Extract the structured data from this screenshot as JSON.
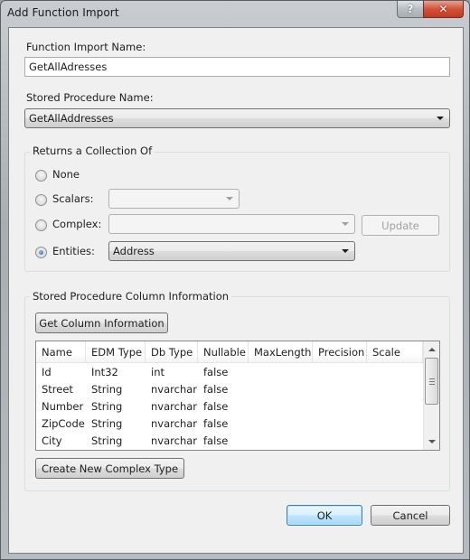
{
  "window": {
    "title": "Add Function Import",
    "help_glyph": "?",
    "close_glyph": "✕"
  },
  "function_import": {
    "label": "Function Import Name:",
    "value": "GetAllAdresses"
  },
  "stored_procedure": {
    "label": "Stored Procedure Name:",
    "selected": "GetAllAddresses"
  },
  "returns_group": {
    "title": "Returns a Collection Of",
    "options": [
      {
        "label": "None",
        "checked": false
      },
      {
        "label": "Scalars:",
        "checked": false,
        "value": ""
      },
      {
        "label": "Complex:",
        "checked": false,
        "value": ""
      },
      {
        "label": "Entities:",
        "checked": true,
        "value": "Address"
      }
    ],
    "update_button": "Update"
  },
  "column_info_group": {
    "title": "Stored Procedure Column Information",
    "get_button": "Get Column Information",
    "columns": [
      "Name",
      "EDM Type",
      "Db Type",
      "Nullable",
      "MaxLength",
      "Precision",
      "Scale"
    ],
    "rows": [
      [
        "Id",
        "Int32",
        "int",
        "false",
        "",
        "",
        ""
      ],
      [
        "Street",
        "String",
        "nvarchar",
        "false",
        "",
        "",
        ""
      ],
      [
        "Number",
        "String",
        "nvarchar",
        "false",
        "",
        "",
        ""
      ],
      [
        "ZipCode",
        "String",
        "nvarchar",
        "false",
        "",
        "",
        ""
      ],
      [
        "City",
        "String",
        "nvarchar",
        "false",
        "",
        "",
        ""
      ]
    ],
    "create_button": "Create New Complex Type"
  },
  "footer": {
    "ok": "OK",
    "cancel": "Cancel"
  }
}
